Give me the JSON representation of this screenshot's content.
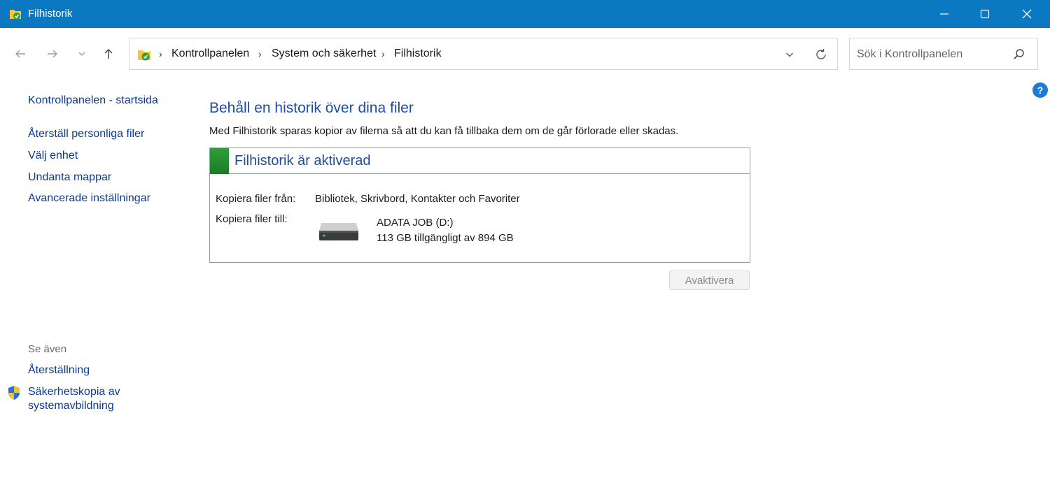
{
  "window": {
    "title": "Filhistorik",
    "titlebar_color": "#0b78c2"
  },
  "nav": {
    "breadcrumbs": [
      "Kontrollpanelen",
      "System och säkerhet",
      "Filhistorik"
    ],
    "search_placeholder": "Sök i Kontrollpanelen"
  },
  "help": {
    "label": "?"
  },
  "sidebar": {
    "home_link": "Kontrollpanelen - startsida",
    "links": [
      "Återställ personliga filer",
      "Välj enhet",
      "Undanta mappar",
      "Avancerade inställningar"
    ],
    "see_also_label": "Se även",
    "see_also_links": [
      "Återställning",
      "Säkerhetskopia av",
      "systemavbildning"
    ]
  },
  "main": {
    "heading": "Behåll en historik över dina filer",
    "description": "Med Filhistorik sparas kopior av filerna så att du kan få tillbaka dem om de går förlorade eller skadas.",
    "status": {
      "title": "Filhistorik är aktiverad",
      "status_color": "#2e9e3a",
      "copy_from_label": "Kopiera filer från:",
      "copy_from_value": "Bibliotek, Skrivbord, Kontakter och Favoriter",
      "copy_to_label": "Kopiera filer till:",
      "drive_name": "ADATA JOB (D:)",
      "drive_space": "113 GB tillgängligt av 894 GB"
    },
    "deactivate_label": "Avaktivera"
  }
}
